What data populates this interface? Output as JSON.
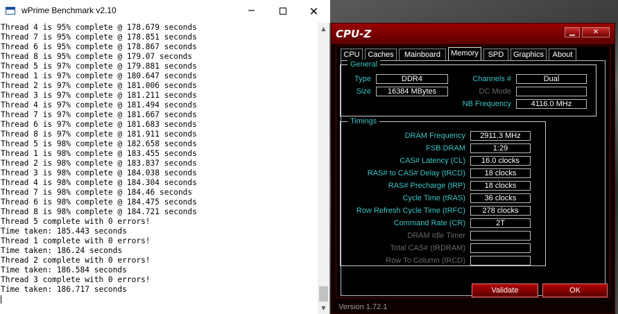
{
  "wprime": {
    "title": "wPrime Benchmark v2.10",
    "min_glyph": "─",
    "close_glyph": "✕",
    "scroll_up": "▲",
    "scroll_down": "▼",
    "console_lines": [
      "Thread 4 is 95% complete @ 178.679 seconds",
      "Thread 7 is 95% complete @ 178.851 seconds",
      "Thread 6 is 95% complete @ 178.867 seconds",
      "Thread 8 is 95% complete @ 179.07 seconds",
      "Thread 5 is 97% complete @ 179.881 seconds",
      "Thread 1 is 97% complete @ 180.647 seconds",
      "Thread 2 is 97% complete @ 181.006 seconds",
      "Thread 3 is 97% complete @ 181.211 seconds",
      "Thread 4 is 97% complete @ 181.494 seconds",
      "Thread 7 is 97% complete @ 181.667 seconds",
      "Thread 6 is 97% complete @ 181.683 seconds",
      "Thread 8 is 97% complete @ 181.911 seconds",
      "Thread 5 is 98% complete @ 182.658 seconds",
      "Thread 1 is 98% complete @ 183.455 seconds",
      "Thread 2 is 98% complete @ 183.837 seconds",
      "Thread 3 is 98% complete @ 184.038 seconds",
      "Thread 4 is 98% complete @ 184.304 seconds",
      "Thread 7 is 98% complete @ 184.46 seconds",
      "Thread 6 is 98% complete @ 184.475 seconds",
      "Thread 8 is 98% complete @ 184.721 seconds",
      "Thread 5 complete with 0 errors!",
      "Time taken: 185.443 seconds",
      "Thread 1 complete with 0 errors!",
      "Time taken: 186.24 seconds",
      "Thread 2 complete with 0 errors!",
      "Time taken: 186.584 seconds",
      "Thread 3 complete with 0 errors!",
      "Time taken: 186.717 seconds"
    ]
  },
  "cpuz": {
    "title": "CPU-Z",
    "min_glyph": "▁",
    "close_glyph": "✕",
    "tabs": [
      "CPU",
      "Caches",
      "Mainboard",
      "Memory",
      "SPD",
      "Graphics",
      "About"
    ],
    "active_tab": "Memory",
    "general": {
      "legend": "General",
      "type_label": "Type",
      "type_value": "DDR4",
      "size_label": "Size",
      "size_value": "16384 MBytes",
      "channels_label": "Channels #",
      "channels_value": "Dual",
      "dc_mode_label": "DC Mode",
      "dc_mode_value": "",
      "nb_freq_label": "NB Frequency",
      "nb_freq_value": "4116.0 MHz"
    },
    "timings": {
      "legend": "Timings",
      "rows": [
        {
          "label": "DRAM Frequency",
          "value": "2911.3 MHz",
          "enabled": true
        },
        {
          "label": "FSB:DRAM",
          "value": "1:29",
          "enabled": true
        },
        {
          "label": "CAS# Latency (CL)",
          "value": "16.0 clocks",
          "enabled": true
        },
        {
          "label": "RAS# to CAS# Delay (tRCD)",
          "value": "18 clocks",
          "enabled": true
        },
        {
          "label": "RAS# Precharge (tRP)",
          "value": "18 clocks",
          "enabled": true
        },
        {
          "label": "Cycle Time (tRAS)",
          "value": "36 clocks",
          "enabled": true
        },
        {
          "label": "Row Refresh Cycle Time (tRFC)",
          "value": "278 clocks",
          "enabled": true
        },
        {
          "label": "Command Rate (CR)",
          "value": "2T",
          "enabled": true
        },
        {
          "label": "DRAM Idle Timer",
          "value": "",
          "enabled": false
        },
        {
          "label": "Total CAS# (tRDRAM)",
          "value": "",
          "enabled": false
        },
        {
          "label": "Row To Column (tRCD)",
          "value": "",
          "enabled": false
        }
      ]
    },
    "validate_label": "Validate",
    "ok_label": "OK",
    "version": "Version 1.72.1"
  }
}
